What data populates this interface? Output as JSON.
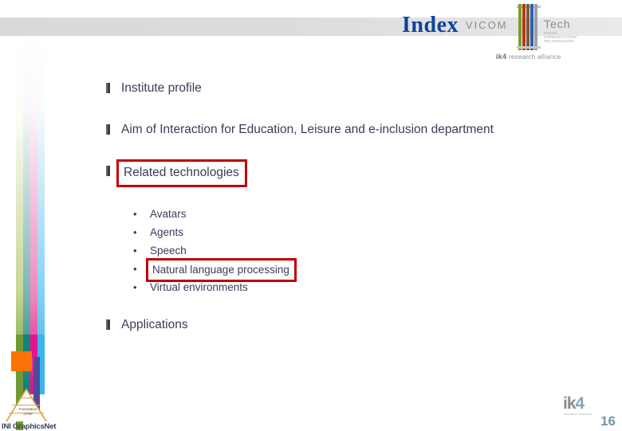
{
  "slide": {
    "title": "Index",
    "page_number": "16"
  },
  "brand_header": {
    "vicom_word": "VICOM",
    "tech_word": "Tech",
    "tagline_line1": "VISUAL",
    "tagline_line2": "COMMUNICATION",
    "tagline_line3": "TECHNOLOGIES",
    "alliance_mark": "ik4",
    "alliance_text": "research alliance"
  },
  "outline": {
    "items": [
      {
        "marker": "▮",
        "label": "Institute profile",
        "boxed": false
      },
      {
        "marker": "▮",
        "label": "Aim of Interaction for Education, Leisure  and e-inclusion department",
        "boxed": false
      },
      {
        "marker": "▮",
        "label": "Related technologies",
        "boxed": true
      },
      {
        "marker": "▮",
        "label": "Applications",
        "boxed": false
      }
    ],
    "sub_items": [
      {
        "bullet": "•",
        "label": "Avatars",
        "boxed": false
      },
      {
        "bullet": "•",
        "label": "Agents",
        "boxed": false
      },
      {
        "bullet": "•",
        "label": "Speech",
        "boxed": false
      },
      {
        "bullet": "•",
        "label": "Natural language processing",
        "boxed": true
      },
      {
        "bullet": "•",
        "label": "Virtual environments",
        "boxed": false
      }
    ]
  },
  "footer_left": {
    "triangle_label_line1": "Foundation",
    "triangle_label_line2": "of the",
    "org_name": "INI GraphicsNet"
  },
  "footer_right": {
    "ik4_ik": "ik",
    "ik4_4": "4",
    "ik4_sub": "research alliance"
  },
  "colors": {
    "title_blue": "#11429b",
    "body_navy": "#3b3b5c",
    "highlight_red": "#c00000",
    "page_number": "#6f9aa8",
    "band_gray": "#d9d9d9"
  }
}
